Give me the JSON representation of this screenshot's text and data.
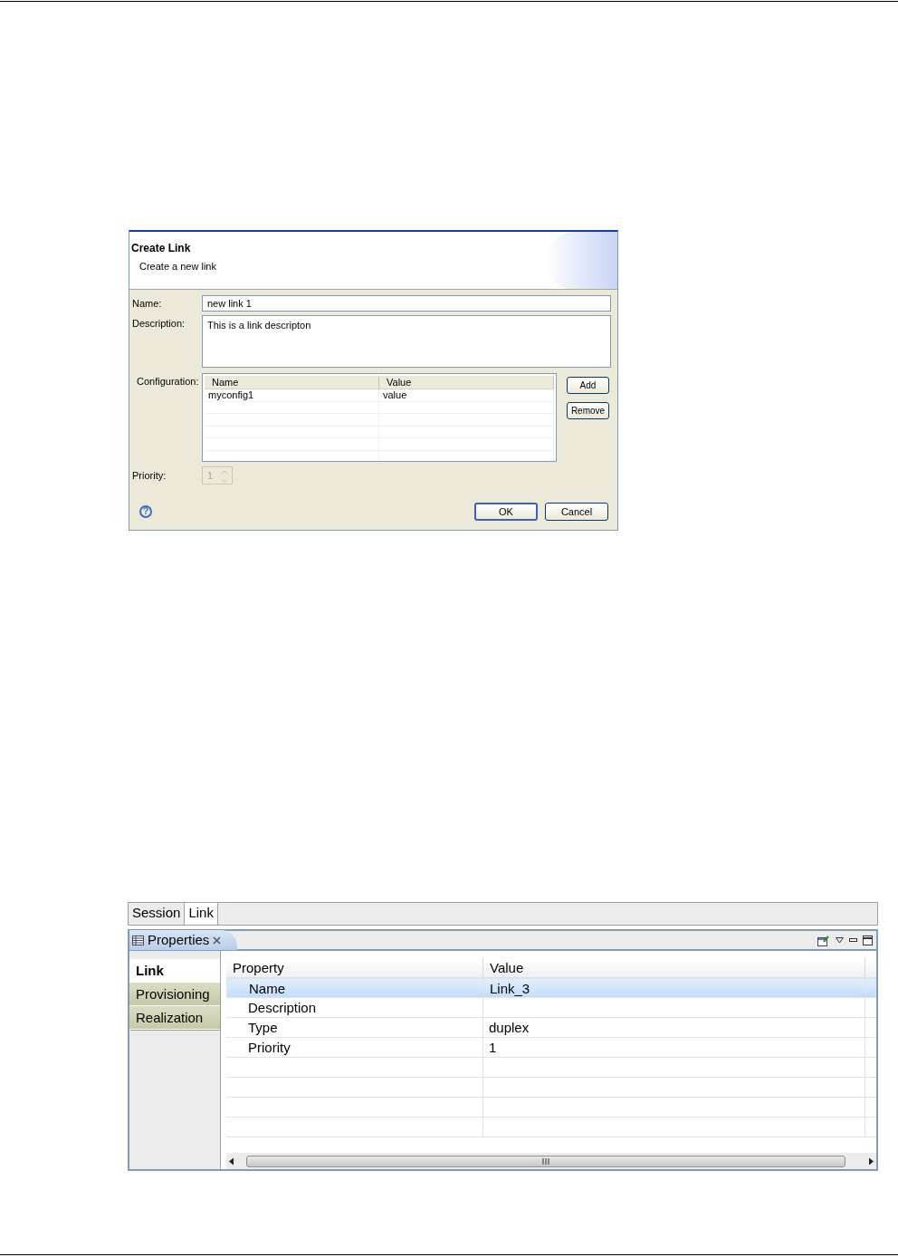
{
  "dialog": {
    "title": "Create Link",
    "subtitle": "Create a new link",
    "name": {
      "label": "Name:",
      "value": "new link 1"
    },
    "description": {
      "label": "Description:",
      "value": "This is a link descripton"
    },
    "configuration": {
      "label": "Configuration:",
      "columns": [
        "Name",
        "Value"
      ],
      "rows": [
        [
          "myconfig1",
          "value"
        ]
      ],
      "buttons": [
        "Add",
        "Remove"
      ]
    },
    "priority": {
      "label": "Priority:",
      "value": "1",
      "disabled": true
    },
    "help": "?",
    "buttons": [
      {
        "label": "OK",
        "default": true
      },
      {
        "label": "Cancel",
        "default": false
      }
    ]
  },
  "perspective_tabs": [
    {
      "label": "Session",
      "selected": false
    },
    {
      "label": "Link",
      "selected": true
    }
  ],
  "view": {
    "title": "Properties",
    "side_tabs": [
      {
        "label": "Link",
        "selected": true
      },
      {
        "label": "Provisioning",
        "selected": false
      },
      {
        "label": "Realization",
        "selected": false
      }
    ],
    "table": {
      "columns": [
        "Property",
        "Value"
      ],
      "rows": [
        {
          "property": "Name",
          "value": "Link_3",
          "selected": true
        },
        {
          "property": "Description",
          "value": "",
          "selected": false
        },
        {
          "property": "Type",
          "value": "duplex",
          "selected": false
        },
        {
          "property": "Priority",
          "value": "1",
          "selected": false
        }
      ]
    }
  }
}
